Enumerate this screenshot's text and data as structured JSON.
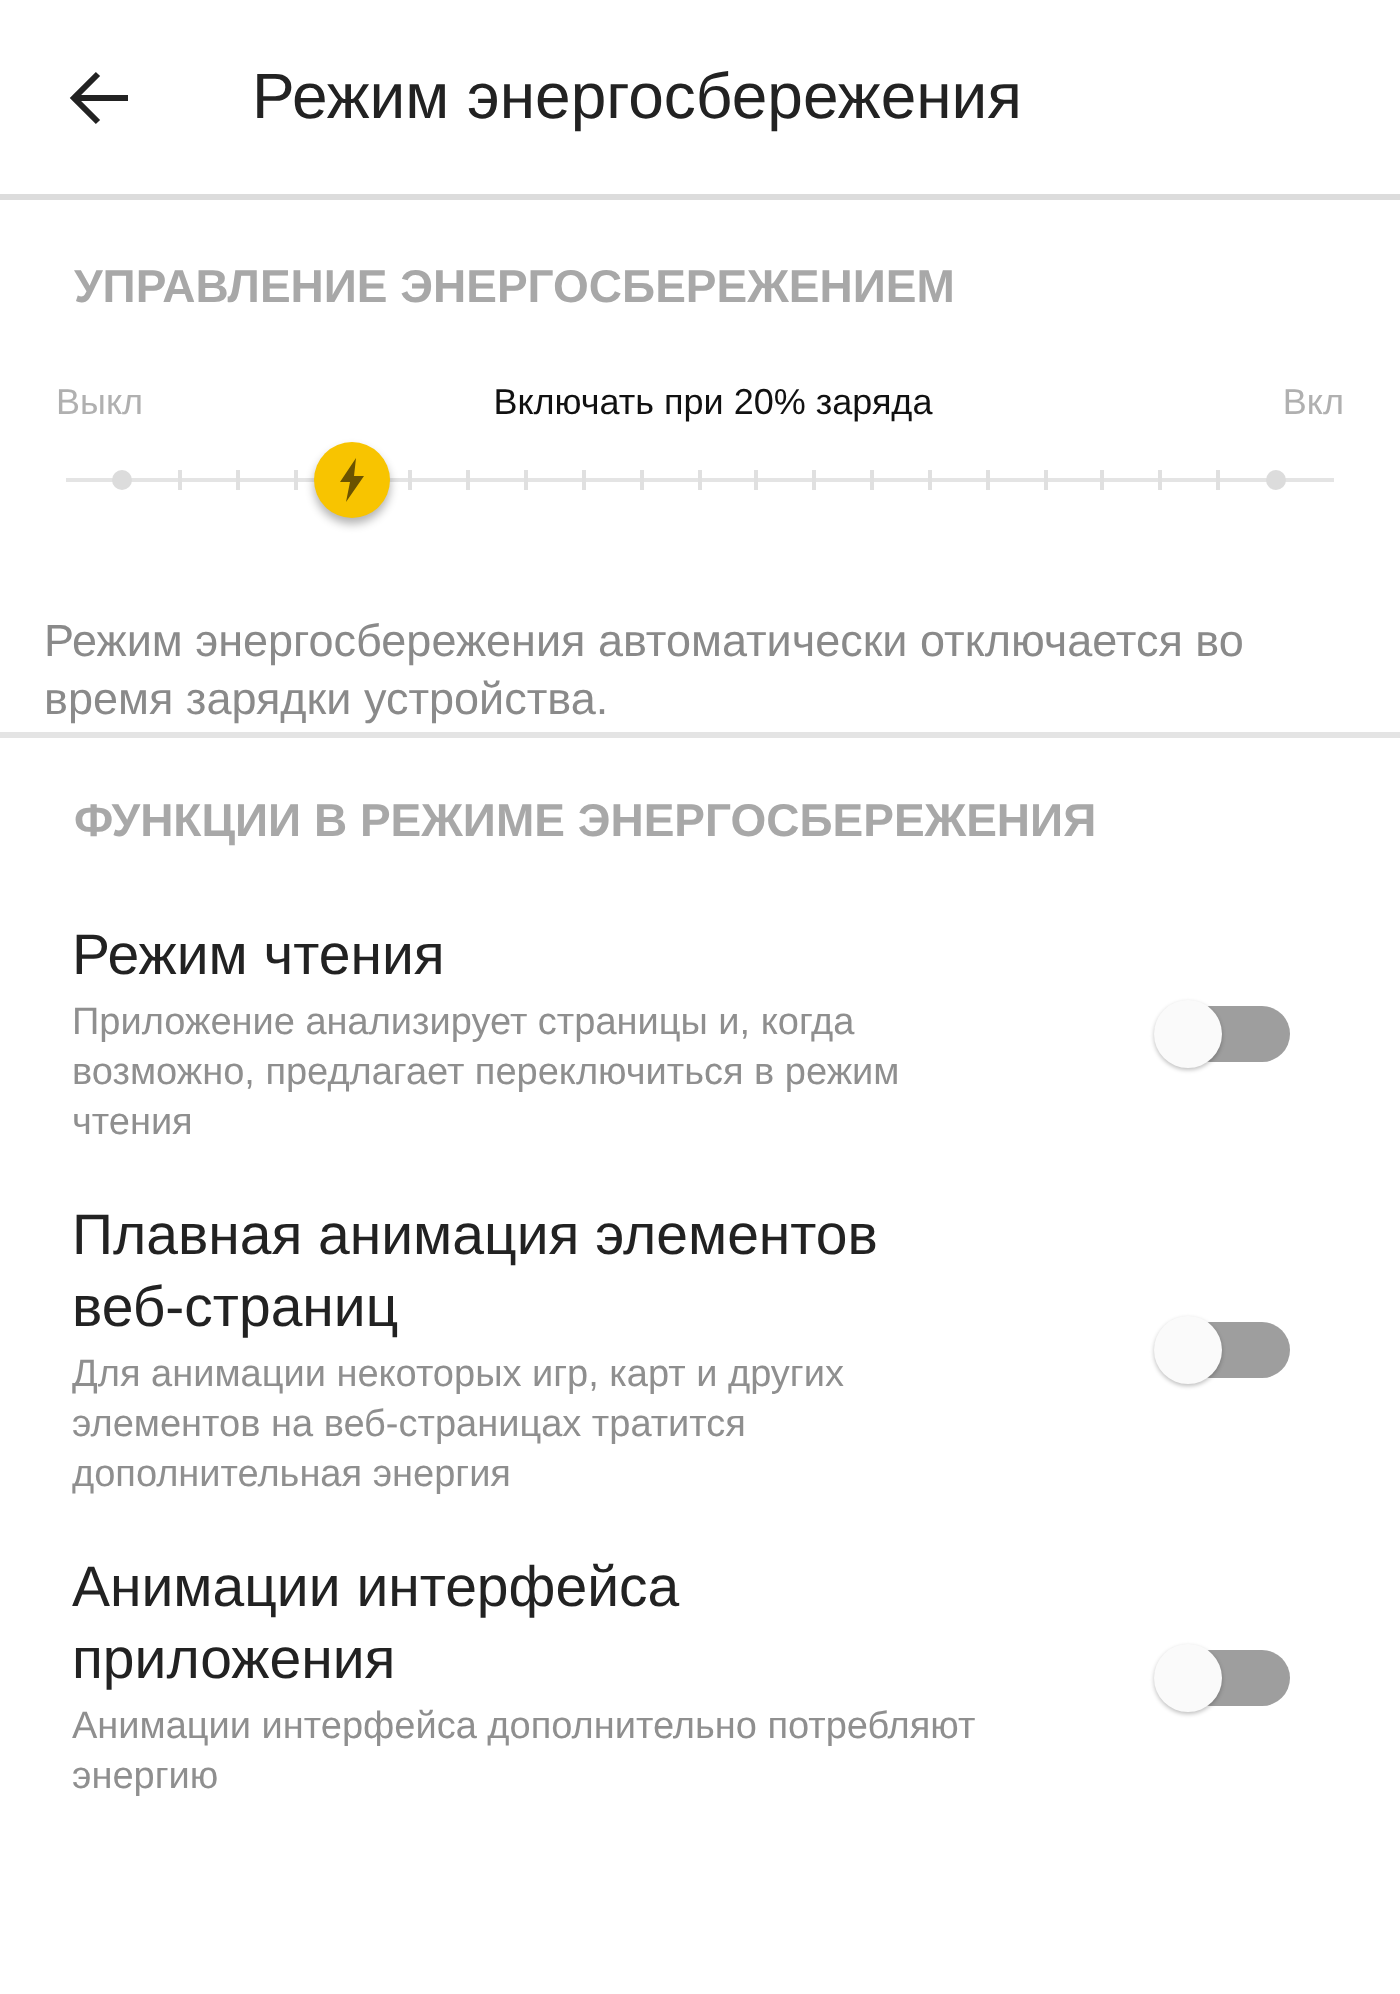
{
  "header": {
    "title": "Режим энергосбережения"
  },
  "power_section": {
    "heading": "УПРАВЛЕНИЕ ЭНЕРГОСБЕРЕЖЕНИЕМ",
    "min_label": "Выкл",
    "max_label": "Вкл",
    "slider_caption": "Включать при 20% заряда",
    "level": 0.2,
    "note": "Режим энергосбережения автоматически отключается во время зарядки устройства."
  },
  "features_section": {
    "heading": "ФУНКЦИИ В РЕЖИМЕ ЭНЕРГОСБЕРЕЖЕНИЯ",
    "items": [
      {
        "title": "Режим чтения",
        "description": "Приложение анализирует страницы и, когда возможно, предлагает переключиться в режим чтения",
        "on": false
      },
      {
        "title": "Плавная анимация элементов веб-страниц",
        "description": "Для анимации некоторых игр, карт и других элементов на веб-страницах тратится дополнительная энергия",
        "on": false
      },
      {
        "title": "Анимации интерфейса приложения",
        "description": "Анимации интерфейса дополнительно потребляют энергию",
        "on": false
      }
    ]
  }
}
